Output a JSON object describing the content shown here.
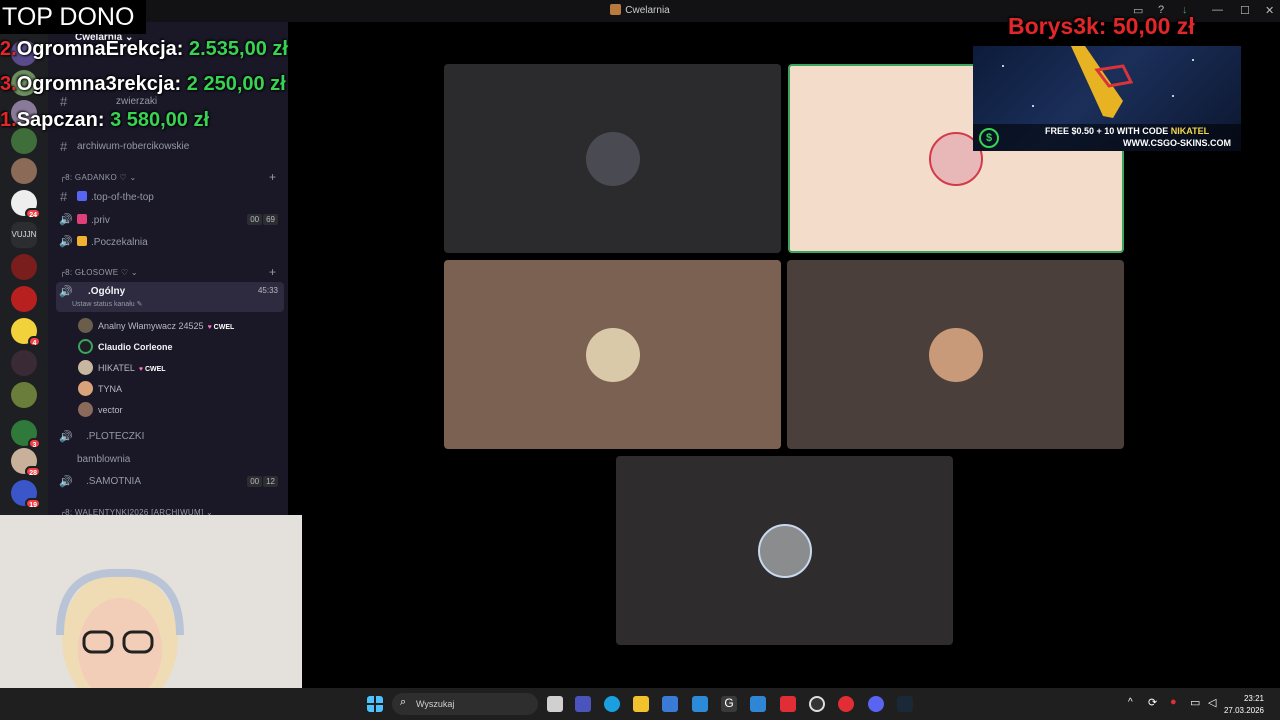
{
  "window": {
    "title": "Cwelarnia",
    "controls": [
      "▭",
      "?",
      "↓",
      "—",
      "☐",
      "✕"
    ]
  },
  "server": {
    "name": "Cwelarnia",
    "badges": [
      "24",
      "4",
      "3",
      "28",
      "19"
    ],
    "vujn_label": "VUJJN"
  },
  "channels": {
    "items_top": [
      {
        "label": "zwierzaki"
      },
      {
        "label": "archiwum-robercikowskie"
      }
    ],
    "category_gadanko": "GADANKO",
    "gadanko_items": [
      {
        "label": ".top-of-the-top"
      },
      {
        "label": ".priv",
        "counter": [
          "00",
          "69"
        ]
      },
      {
        "label": ".Poczekalnia"
      }
    ],
    "category_glosowe": "GŁOSOWE",
    "active_channel": {
      "label": ".Ogólny",
      "time": "45:33",
      "status": "Ustaw status kanału"
    },
    "members": [
      {
        "name": "Analny Włamywacz 24525",
        "tag": "CWEL"
      },
      {
        "name": "Claudio Corleone"
      },
      {
        "name": "HIKATEL",
        "tag": "CWEL"
      },
      {
        "name": "TYNA"
      },
      {
        "name": "vector"
      }
    ],
    "more_items": [
      {
        "label": ".PLOTECZKI"
      },
      {
        "label": "bamblownia"
      },
      {
        "label": ".SAMOTNIA",
        "counter": [
          "00",
          "12"
        ]
      }
    ],
    "category_walentynki": "WALENTYNKI2026 [ARCHIWUM]"
  },
  "overlay": {
    "top_dono": "TOP DONO",
    "donors": [
      {
        "rank": "2.",
        "name": "OgromnaErekcja:",
        "amount": "2.535,00 zł"
      },
      {
        "rank": "3.",
        "name": "Ogromna3rekcja:",
        "amount": "2 250,00 zł"
      },
      {
        "rank": "1.",
        "name": "Sapczan:",
        "amount": "3 580,00 zł"
      }
    ],
    "latest": {
      "name": "Borys3k:",
      "amount": "50,00 zł"
    }
  },
  "ad": {
    "line1_prefix": "FREE $0.50 + 10",
    "line1_mid": " WITH CODE ",
    "code": "NIKATEL",
    "line2": "WWW.CSGO-SKINS.COM",
    "coin": "$"
  },
  "taskbar": {
    "search_placeholder": "Wyszukaj",
    "time": "23:21",
    "date": "27.03.2026"
  },
  "colors": {
    "donor_amount": "#39d353",
    "latest_name": "#e3262a",
    "speaking_border": "#3ba55d"
  }
}
